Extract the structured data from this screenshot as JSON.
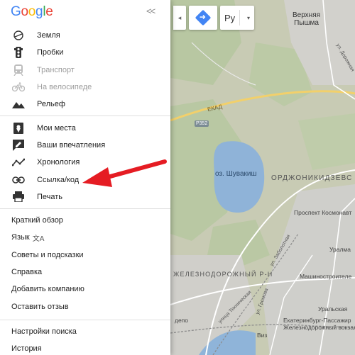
{
  "logo": {
    "letters": [
      "G",
      "o",
      "o",
      "g",
      "l",
      "e"
    ],
    "colors": [
      "#4285f4",
      "#ea4335",
      "#fbbc05",
      "#4285f4",
      "#34a853",
      "#ea4335"
    ]
  },
  "panel": {
    "collapse_icon": "double-chevron-left-icon",
    "layers": [
      {
        "label": "Земля",
        "icon": "earth-icon",
        "disabled": false
      },
      {
        "label": "Пробки",
        "icon": "traffic-light-icon",
        "disabled": false
      },
      {
        "label": "Транспорт",
        "icon": "train-icon",
        "disabled": true
      },
      {
        "label": "На велосипеде",
        "icon": "bicycle-icon",
        "disabled": true
      },
      {
        "label": "Рельеф",
        "icon": "terrain-icon",
        "disabled": false
      }
    ],
    "tools": [
      {
        "label": "Мои места",
        "icon": "place-pin-icon"
      },
      {
        "label": "Ваши впечатления",
        "icon": "rate-review-icon"
      },
      {
        "label": "Хронология",
        "icon": "timeline-icon"
      },
      {
        "label": "Ссылка/код",
        "icon": "link-icon"
      },
      {
        "label": "Печать",
        "icon": "printer-icon"
      }
    ],
    "help": {
      "tour": "Краткий обзор",
      "language": "Язык",
      "language_icon": "translate-icon",
      "tips": "Советы и подсказки",
      "help": "Справка",
      "add_business": "Добавить компанию",
      "feedback": "Оставить отзыв"
    },
    "settings": {
      "search_settings": "Настройки поиска",
      "history": "История"
    }
  },
  "controls": {
    "directions_icon": "directions-icon",
    "language_value": "Ру",
    "language_caret": "▾"
  },
  "map": {
    "labels": {
      "city_top": "Верхняя\nПышма",
      "lake": "оз. Шувакиш",
      "district_ord": "ОРДЖОНИКИДЗЕВС",
      "district_rail": "ЖЕЛЕЗНОДОРОЖНЫЙ Р-Н",
      "prospect": "Проспект Космонавт",
      "uralmash": "Уралма",
      "mashinostroiteley": "Машиностроителе",
      "uralskaya": "Уральская",
      "station": "Екатеринбург-Пассажир\nЖелезнодорожный вокзал",
      "depot": "депо",
      "viz": "Виз",
      "ekad": "ЕКАД",
      "route": "Р352",
      "ul_dorozhnaya": "ул. Дорожная",
      "ul_tekhnicheskaya": "улица Техническая",
      "ul_zabolotnaya": "ул. Заболотная",
      "ul_gromova": "ул. Громова"
    },
    "colors": {
      "land": "#c9c9b4",
      "forest": "#b9c9a3",
      "urban": "#cfcfcf",
      "water": "#8fb4d9",
      "highway": "#f4d36a",
      "road": "#ffffff",
      "rail": "#8a8a8a"
    }
  },
  "annotation": {
    "arrow_color": "#e51c23"
  }
}
